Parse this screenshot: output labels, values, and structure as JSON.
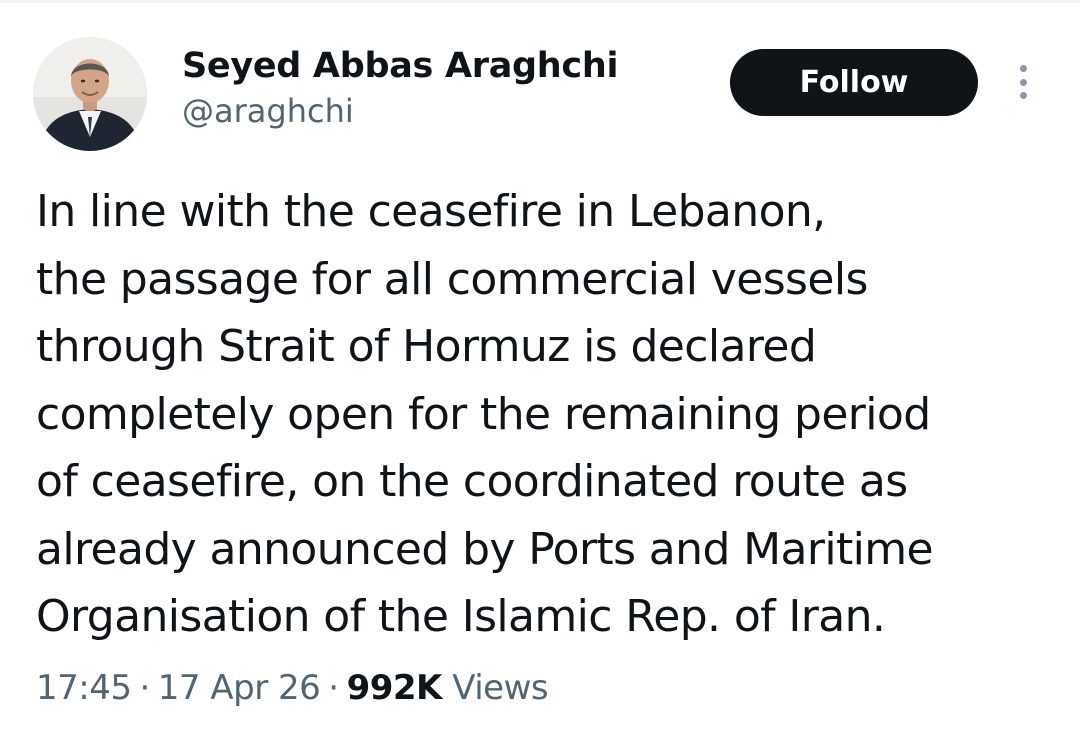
{
  "tweet": {
    "author": {
      "display_name": "Seyed Abbas Araghchi",
      "handle": "@araghchi"
    },
    "follow_label": "Follow",
    "text_lines": [
      "In line with the ceasefire in Lebanon,",
      "the passage for all commercial vessels",
      "through Strait of Hormuz is declared",
      "completely open for the remaining period",
      "of ceasefire, on the coordinated route as",
      "already announced by Ports and Maritime",
      "Organisation of the Islamic Rep. of Iran."
    ],
    "meta": {
      "time": "17:45",
      "separator": "·",
      "date": "17 Apr 26",
      "views_count": "992K",
      "views_label": "Views"
    }
  },
  "colors": {
    "text_primary": "#0f1419",
    "text_secondary": "#536471",
    "follow_bg": "#0f1419",
    "follow_text": "#ffffff"
  },
  "icons": {
    "more": "more-options-icon"
  }
}
